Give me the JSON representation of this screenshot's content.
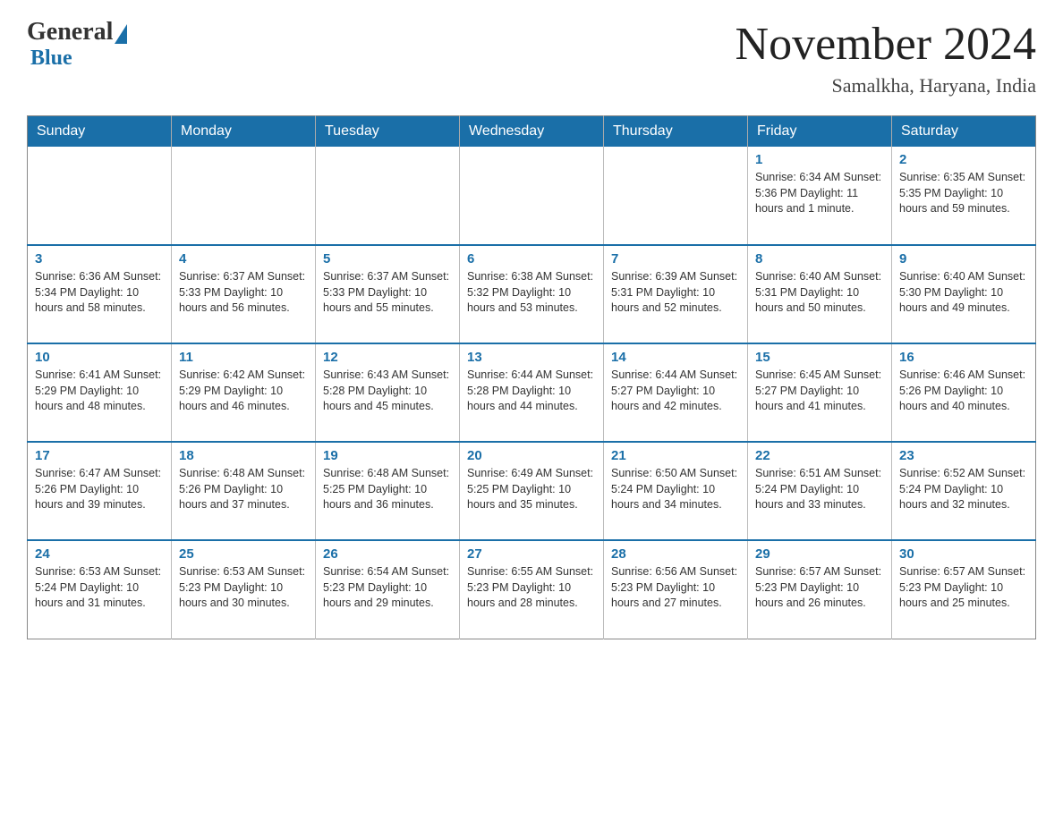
{
  "header": {
    "logo_general": "General",
    "logo_blue": "Blue",
    "month_title": "November 2024",
    "location": "Samalkha, Haryana, India"
  },
  "weekdays": [
    "Sunday",
    "Monday",
    "Tuesday",
    "Wednesday",
    "Thursday",
    "Friday",
    "Saturday"
  ],
  "weeks": [
    [
      {
        "day": "",
        "info": ""
      },
      {
        "day": "",
        "info": ""
      },
      {
        "day": "",
        "info": ""
      },
      {
        "day": "",
        "info": ""
      },
      {
        "day": "",
        "info": ""
      },
      {
        "day": "1",
        "info": "Sunrise: 6:34 AM\nSunset: 5:36 PM\nDaylight: 11 hours and 1 minute."
      },
      {
        "day": "2",
        "info": "Sunrise: 6:35 AM\nSunset: 5:35 PM\nDaylight: 10 hours and 59 minutes."
      }
    ],
    [
      {
        "day": "3",
        "info": "Sunrise: 6:36 AM\nSunset: 5:34 PM\nDaylight: 10 hours and 58 minutes."
      },
      {
        "day": "4",
        "info": "Sunrise: 6:37 AM\nSunset: 5:33 PM\nDaylight: 10 hours and 56 minutes."
      },
      {
        "day": "5",
        "info": "Sunrise: 6:37 AM\nSunset: 5:33 PM\nDaylight: 10 hours and 55 minutes."
      },
      {
        "day": "6",
        "info": "Sunrise: 6:38 AM\nSunset: 5:32 PM\nDaylight: 10 hours and 53 minutes."
      },
      {
        "day": "7",
        "info": "Sunrise: 6:39 AM\nSunset: 5:31 PM\nDaylight: 10 hours and 52 minutes."
      },
      {
        "day": "8",
        "info": "Sunrise: 6:40 AM\nSunset: 5:31 PM\nDaylight: 10 hours and 50 minutes."
      },
      {
        "day": "9",
        "info": "Sunrise: 6:40 AM\nSunset: 5:30 PM\nDaylight: 10 hours and 49 minutes."
      }
    ],
    [
      {
        "day": "10",
        "info": "Sunrise: 6:41 AM\nSunset: 5:29 PM\nDaylight: 10 hours and 48 minutes."
      },
      {
        "day": "11",
        "info": "Sunrise: 6:42 AM\nSunset: 5:29 PM\nDaylight: 10 hours and 46 minutes."
      },
      {
        "day": "12",
        "info": "Sunrise: 6:43 AM\nSunset: 5:28 PM\nDaylight: 10 hours and 45 minutes."
      },
      {
        "day": "13",
        "info": "Sunrise: 6:44 AM\nSunset: 5:28 PM\nDaylight: 10 hours and 44 minutes."
      },
      {
        "day": "14",
        "info": "Sunrise: 6:44 AM\nSunset: 5:27 PM\nDaylight: 10 hours and 42 minutes."
      },
      {
        "day": "15",
        "info": "Sunrise: 6:45 AM\nSunset: 5:27 PM\nDaylight: 10 hours and 41 minutes."
      },
      {
        "day": "16",
        "info": "Sunrise: 6:46 AM\nSunset: 5:26 PM\nDaylight: 10 hours and 40 minutes."
      }
    ],
    [
      {
        "day": "17",
        "info": "Sunrise: 6:47 AM\nSunset: 5:26 PM\nDaylight: 10 hours and 39 minutes."
      },
      {
        "day": "18",
        "info": "Sunrise: 6:48 AM\nSunset: 5:26 PM\nDaylight: 10 hours and 37 minutes."
      },
      {
        "day": "19",
        "info": "Sunrise: 6:48 AM\nSunset: 5:25 PM\nDaylight: 10 hours and 36 minutes."
      },
      {
        "day": "20",
        "info": "Sunrise: 6:49 AM\nSunset: 5:25 PM\nDaylight: 10 hours and 35 minutes."
      },
      {
        "day": "21",
        "info": "Sunrise: 6:50 AM\nSunset: 5:24 PM\nDaylight: 10 hours and 34 minutes."
      },
      {
        "day": "22",
        "info": "Sunrise: 6:51 AM\nSunset: 5:24 PM\nDaylight: 10 hours and 33 minutes."
      },
      {
        "day": "23",
        "info": "Sunrise: 6:52 AM\nSunset: 5:24 PM\nDaylight: 10 hours and 32 minutes."
      }
    ],
    [
      {
        "day": "24",
        "info": "Sunrise: 6:53 AM\nSunset: 5:24 PM\nDaylight: 10 hours and 31 minutes."
      },
      {
        "day": "25",
        "info": "Sunrise: 6:53 AM\nSunset: 5:23 PM\nDaylight: 10 hours and 30 minutes."
      },
      {
        "day": "26",
        "info": "Sunrise: 6:54 AM\nSunset: 5:23 PM\nDaylight: 10 hours and 29 minutes."
      },
      {
        "day": "27",
        "info": "Sunrise: 6:55 AM\nSunset: 5:23 PM\nDaylight: 10 hours and 28 minutes."
      },
      {
        "day": "28",
        "info": "Sunrise: 6:56 AM\nSunset: 5:23 PM\nDaylight: 10 hours and 27 minutes."
      },
      {
        "day": "29",
        "info": "Sunrise: 6:57 AM\nSunset: 5:23 PM\nDaylight: 10 hours and 26 minutes."
      },
      {
        "day": "30",
        "info": "Sunrise: 6:57 AM\nSunset: 5:23 PM\nDaylight: 10 hours and 25 minutes."
      }
    ]
  ]
}
